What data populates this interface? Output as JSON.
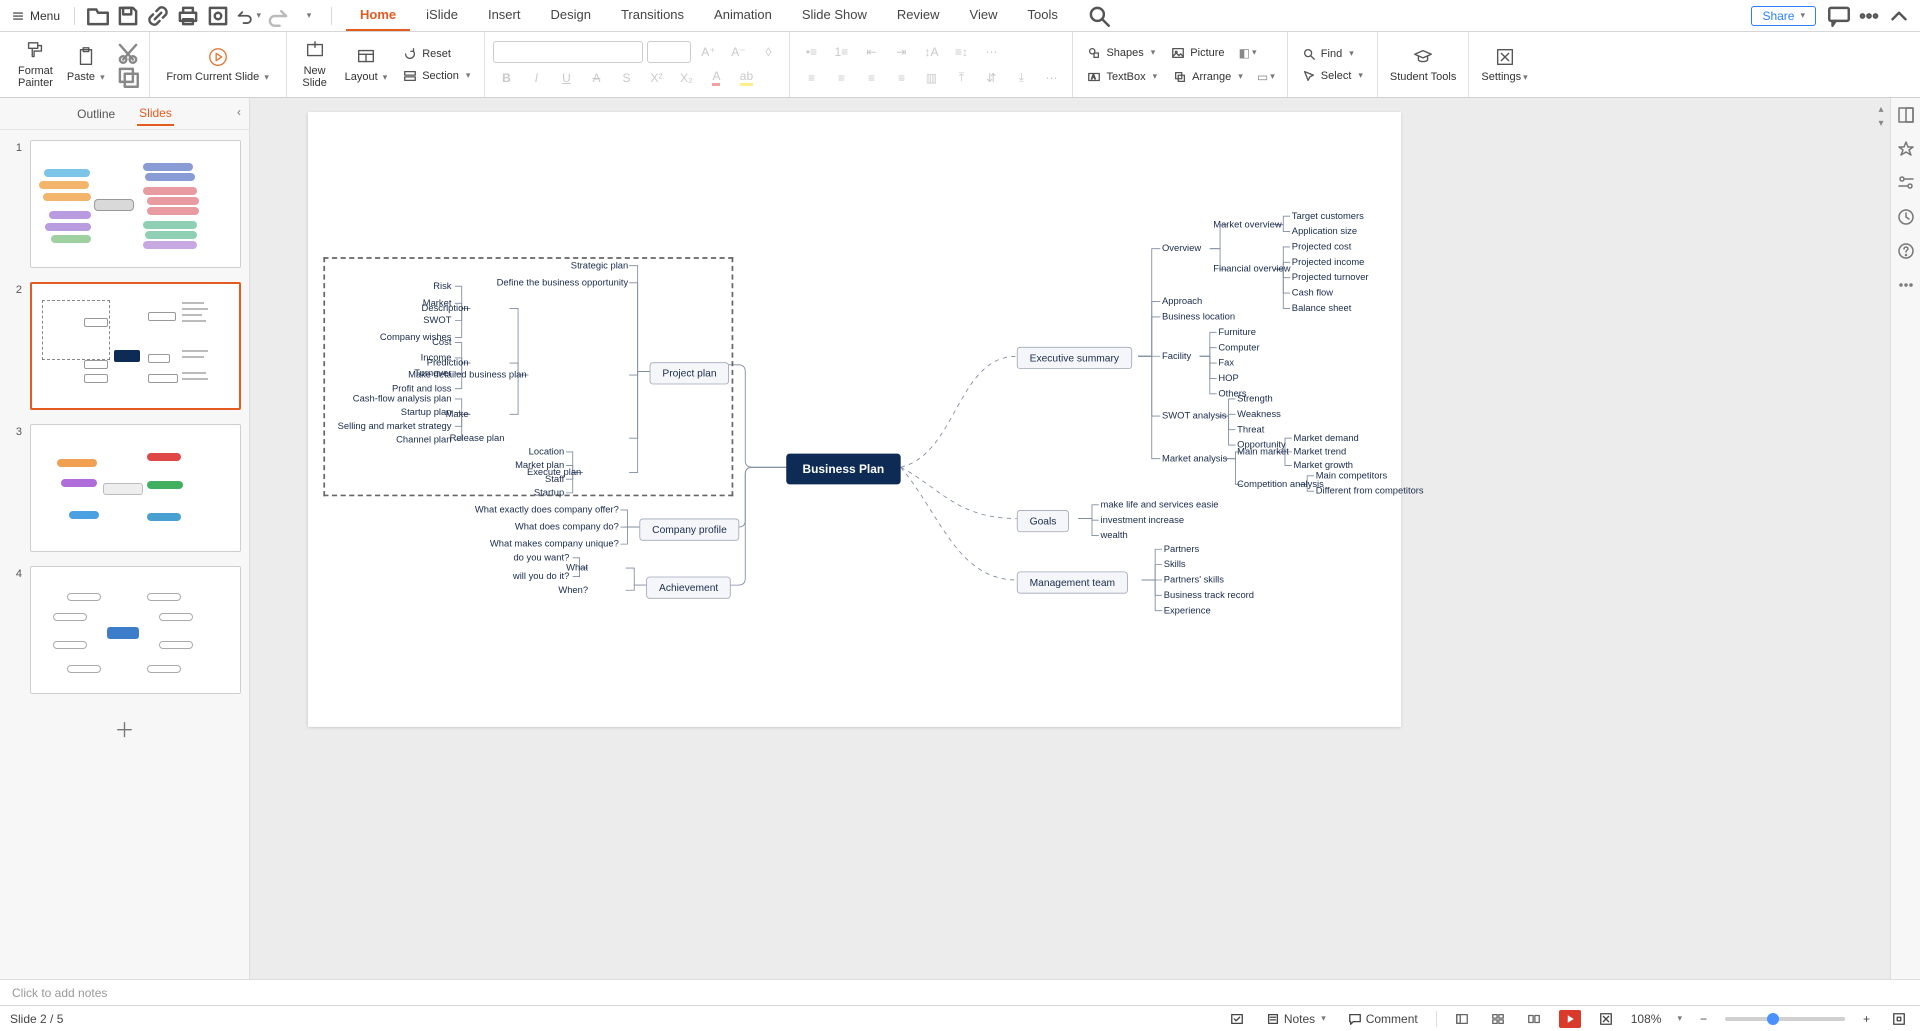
{
  "title_tabs": [
    "Home",
    "iSlide",
    "Insert",
    "Design",
    "Transitions",
    "Animation",
    "Slide Show",
    "Review",
    "View",
    "Tools"
  ],
  "active_tab": "Home",
  "menu_label": "Menu",
  "share_label": "Share",
  "ribbon": {
    "format_painter": "Format\nPainter",
    "paste": "Paste",
    "from_slide": "From Current Slide",
    "new_slide": "New\nSlide",
    "layout": "Layout",
    "reset": "Reset",
    "section": "Section",
    "shapes": "Shapes",
    "picture": "Picture",
    "textbox": "TextBox",
    "arrange": "Arrange",
    "find": "Find",
    "select": "Select",
    "student": "Student Tools",
    "settings": "Settings"
  },
  "left_tabs": {
    "outline": "Outline",
    "slides": "Slides"
  },
  "thumb_numbers": [
    "1",
    "2",
    "3",
    "4"
  ],
  "slide_counter": "Slide 2 / 5",
  "notes_placeholder": "Click to add notes",
  "status": {
    "notes": "Notes",
    "comment": "Comment",
    "zoom": "108%"
  },
  "mindmap": {
    "center": "Business Plan",
    "left_main": [
      "Project plan",
      "Company profile",
      "Achievement"
    ],
    "right_main": [
      "Executive summary",
      "Goals",
      "Management team"
    ],
    "project_plan_subs": [
      "Strategic plan",
      "Define the business opportunity",
      "Make detailed business plan",
      "Release plan",
      "Execute plan"
    ],
    "description_label": "Description",
    "description_items": [
      "Risk",
      "Market",
      "SWOT",
      "Company wishes"
    ],
    "prediction_label": "Prediction",
    "prediction_items": [
      "Cost",
      "Income",
      "Turnover",
      "Profit and loss"
    ],
    "make_label": "Make",
    "make_items": [
      "Cash-flow analysis plan",
      "Startup plan",
      "Selling and market strategy",
      "Channel plan"
    ],
    "execute_items": [
      "Location",
      "Market plan",
      "Staff",
      "Startup"
    ],
    "company_profile_items": [
      "What exactly does company offer?",
      "What does company do?",
      "What makes company unique?"
    ],
    "achievement_what": "What",
    "achievement_what_items": [
      "do you want?",
      "will you do it?"
    ],
    "achievement_when": "When?",
    "exec_overview": "Overview",
    "market_overview": "Market overview",
    "market_overview_items": [
      "Target customers",
      "Application size"
    ],
    "financial_overview": "Financial overview",
    "financial_overview_items": [
      "Projected cost",
      "Projected income",
      "Projected turnover",
      "Cash flow",
      "Balance sheet"
    ],
    "exec_items_simple": [
      "Approach",
      "Business location"
    ],
    "facility": "Facility",
    "facility_items": [
      "Furniture",
      "Computer",
      "Fax",
      "HOP",
      "Others"
    ],
    "swot": "SWOT analysis",
    "swot_items": [
      "Strength",
      "Weakness",
      "Threat",
      "Opportunity"
    ],
    "market_analysis": "Market analysis",
    "main_market": "Main market",
    "main_market_items": [
      "Market demand",
      "Market trend",
      "Market growth"
    ],
    "competition": "Competition analysis",
    "competition_items": [
      "Main competitors",
      "Different from competitors"
    ],
    "goals_items": [
      "make life and services easie",
      "investment increase",
      "wealth"
    ],
    "mgmt_items": [
      "Partners",
      "Skills",
      "Partners' skills",
      "Business track record",
      "Experience"
    ]
  }
}
